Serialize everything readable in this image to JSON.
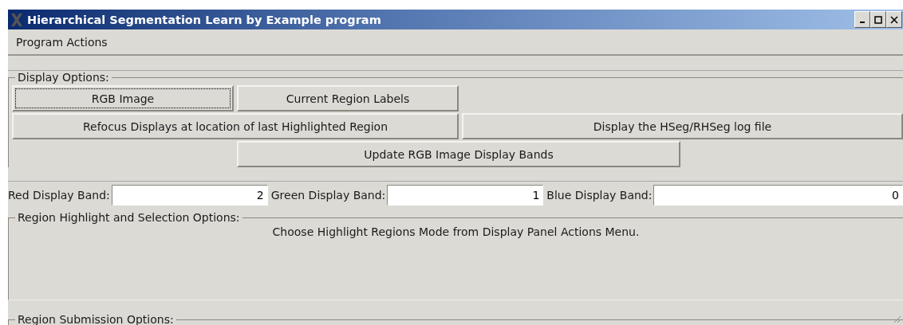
{
  "window": {
    "title": "Hierarchical Segmentation Learn by Example program"
  },
  "menu": [
    {
      "label": "Program Actions"
    }
  ],
  "display_options": {
    "legend": "Display Options:",
    "buttons": [
      {
        "label": "RGB Image",
        "focused": true
      },
      {
        "label": "Current Region Labels",
        "focused": false
      },
      {
        "label": "Refocus Displays at location of last Highlighted Region",
        "focused": false
      },
      {
        "label": "Display the HSeg/RHSeg log file",
        "focused": false
      },
      {
        "label": "Update RGB Image Display Bands",
        "focused": false
      }
    ]
  },
  "bands": [
    {
      "label": "Red Display Band:",
      "value": "2"
    },
    {
      "label": "Green Display Band:",
      "value": "1"
    },
    {
      "label": "Blue Display Band:",
      "value": "0"
    }
  ],
  "highlight_options": {
    "legend": "Region Highlight and Selection Options:",
    "message": "Choose Highlight Regions Mode from Display Panel Actions Menu."
  },
  "submission_options": {
    "legend": "Region Submission Options:"
  }
}
